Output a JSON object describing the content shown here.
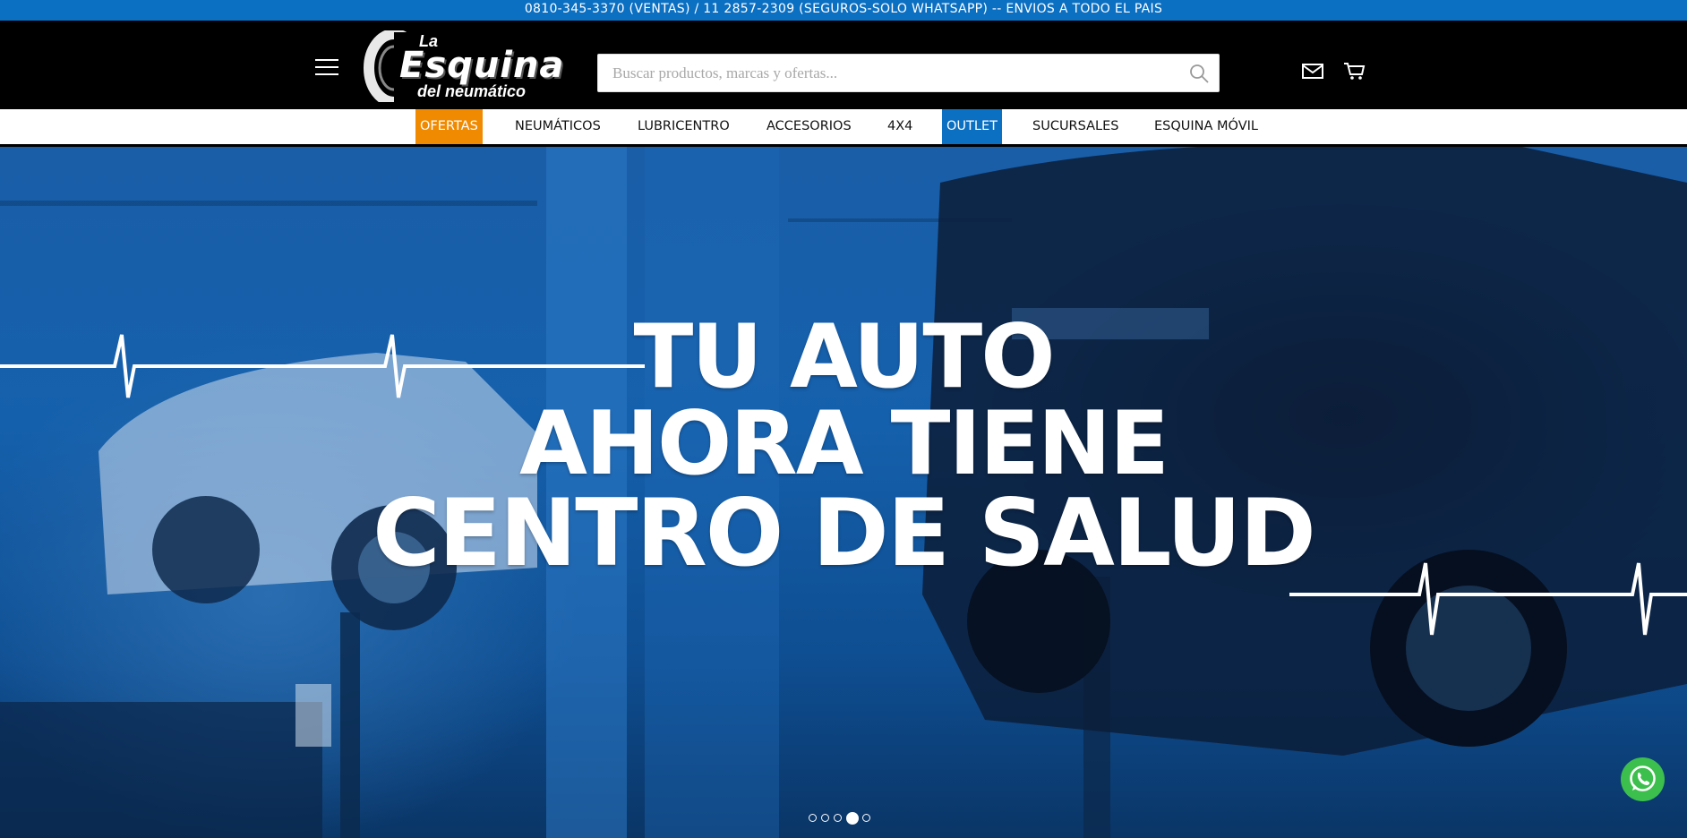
{
  "topbar": {
    "text": "0810-345-3370 (VENTAS) / 11 2857-2309 (SEGUROS-SOLO WHATSAPP) -- ENVIOS A TODO EL PAIS"
  },
  "header": {
    "logo": {
      "line1": "La",
      "line2": "Esquina",
      "line3": "del neumático"
    },
    "search_placeholder": "Buscar productos, marcas y ofertas..."
  },
  "nav": {
    "items": [
      {
        "label": "OFERTAS",
        "highlight": "#f08a00"
      },
      {
        "label": "NEUMÁTICOS"
      },
      {
        "label": "LUBRICENTRO"
      },
      {
        "label": "ACCESORIOS"
      },
      {
        "label": "4X4"
      },
      {
        "label": "OUTLET",
        "highlight": "#0b6fc2"
      },
      {
        "label": "SUCURSALES"
      },
      {
        "label": "ESQUINA MÓVIL"
      }
    ]
  },
  "hero": {
    "line1": "TU AUTO",
    "line2": "AHORA TIENE",
    "line3": "CENTRO DE SALUD",
    "slides": 5,
    "active_slide": 4
  },
  "colors": {
    "topbar": "#0b6fc2",
    "accent_orange": "#f08a00",
    "accent_blue": "#0b6fc2",
    "whatsapp": "#3cbf4c"
  },
  "icons": [
    "menu-icon",
    "search-icon",
    "mail-icon",
    "cart-icon",
    "whatsapp-icon"
  ]
}
